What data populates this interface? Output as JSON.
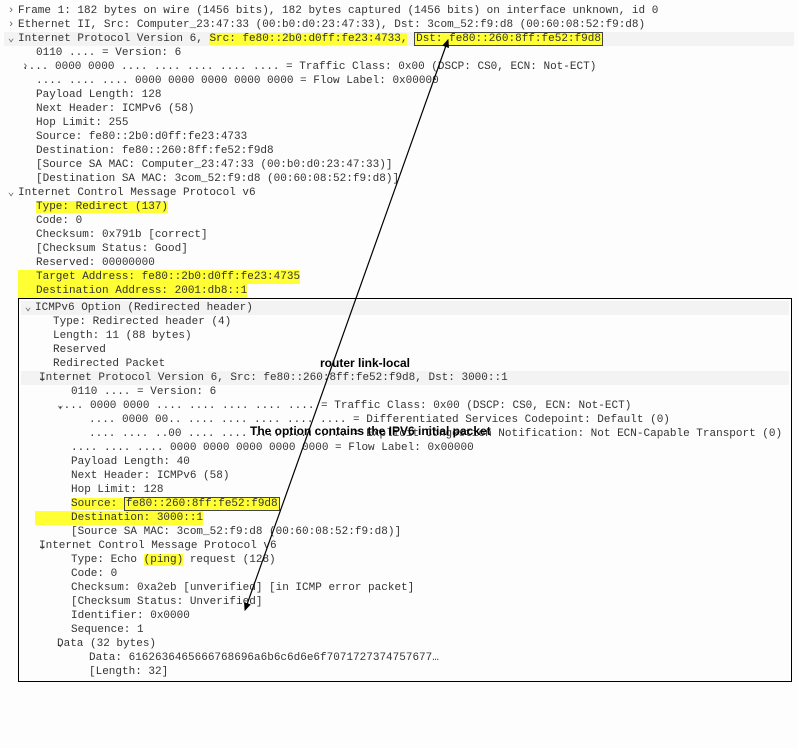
{
  "frame": {
    "summary": "Frame 1: 182 bytes on wire (1456 bits), 182 bytes captured (1456 bits) on interface unknown, id 0"
  },
  "eth": {
    "summary": "Ethernet II, Src: Computer_23:47:33 (00:b0:d0:23:47:33), Dst: 3com_52:f9:d8 (00:60:08:52:f9:d8)"
  },
  "ipv6": {
    "prefix": "Internet Protocol Version 6, ",
    "src_label": "Src: fe80::2b0:d0ff:fe23:4733,",
    "dst_label": "Dst: fe80::260:8ff:fe52:f9d8",
    "version": "0110 .... = Version: 6",
    "tclass": ".... 0000 0000 .... .... .... .... .... = Traffic Class: 0x00 (DSCP: CS0, ECN: Not-ECT)",
    "flow": ".... .... .... 0000 0000 0000 0000 0000 = Flow Label: 0x00000",
    "plen": "Payload Length: 128",
    "nh": "Next Header: ICMPv6 (58)",
    "hop": "Hop Limit: 255",
    "src": "Source: fe80::2b0:d0ff:fe23:4733",
    "dst": "Destination: fe80::260:8ff:fe52:f9d8",
    "samac_src": "[Source SA MAC: Computer_23:47:33 (00:b0:d0:23:47:33)]",
    "samac_dst": "[Destination SA MAC: 3com_52:f9:d8 (00:60:08:52:f9:d8)]"
  },
  "icmpv6": {
    "summary": "Internet Control Message Protocol v6",
    "type_label": "Type: ",
    "type_value": "Redirect (137)",
    "code": "Code: 0",
    "cksum": "Checksum: 0x791b [correct]",
    "cksum_status": "[Checksum Status: Good]",
    "reserved": "Reserved: 00000000",
    "target": "Target Address: fe80::2b0:d0ff:fe23:4735",
    "destaddr": "Destination Address: 2001:db8::1"
  },
  "opt": {
    "summary": "ICMPv6 Option (Redirected header)",
    "type": "Type: Redirected header (4)",
    "length": "Length: 11 (88 bytes)",
    "reserved": "Reserved",
    "redir": "Redirected Packet"
  },
  "inner_ipv6": {
    "summary": "Internet Protocol Version 6, Src: fe80::260:8ff:fe52:f9d8, Dst: 3000::1",
    "version": "0110 .... = Version: 6",
    "tclass": ".... 0000 0000 .... .... .... .... .... = Traffic Class: 0x00 (DSCP: CS0, ECN: Not-ECT)",
    "dscp": ".... 0000 00.. .... .... .... .... .... = Differentiated Services Codepoint: Default (0)",
    "ecn": ".... .... ..00 .... .... .... .... .... = Explicit Congestion Notification: Not ECN-Capable Transport (0)",
    "flow": ".... .... .... 0000 0000 0000 0000 0000 = Flow Label: 0x00000",
    "plen": "Payload Length: 40",
    "nh": "Next Header: ICMPv6 (58)",
    "hop": "Hop Limit: 128",
    "src_label": "Source: ",
    "src_value": "fe80::260:8ff:fe52:f9d8",
    "dst": "Destination: 3000::1",
    "samac_src": "[Source SA MAC: 3com_52:f9:d8 (00:60:08:52:f9:d8)]"
  },
  "inner_icmp": {
    "summary": "Internet Control Message Protocol v6",
    "type_pre": "Type: Echo ",
    "type_hl": "(ping)",
    "type_post": " request (128)",
    "code": "Code: 0",
    "cksum": "Checksum: 0xa2eb [unverified] [in ICMP error packet]",
    "cksum_status": "[Checksum Status: Unverified]",
    "ident": "Identifier: 0x0000",
    "seq": "Sequence: 1",
    "data_summary": "Data (32 bytes)",
    "data_hex": "Data: 6162636465666768696a6b6c6d6e6f7071727374757677…",
    "data_len": "[Length: 32]"
  },
  "annotations": {
    "router_ll": "router link-local",
    "option_text": "The option contains the IPV6 initial packet"
  }
}
